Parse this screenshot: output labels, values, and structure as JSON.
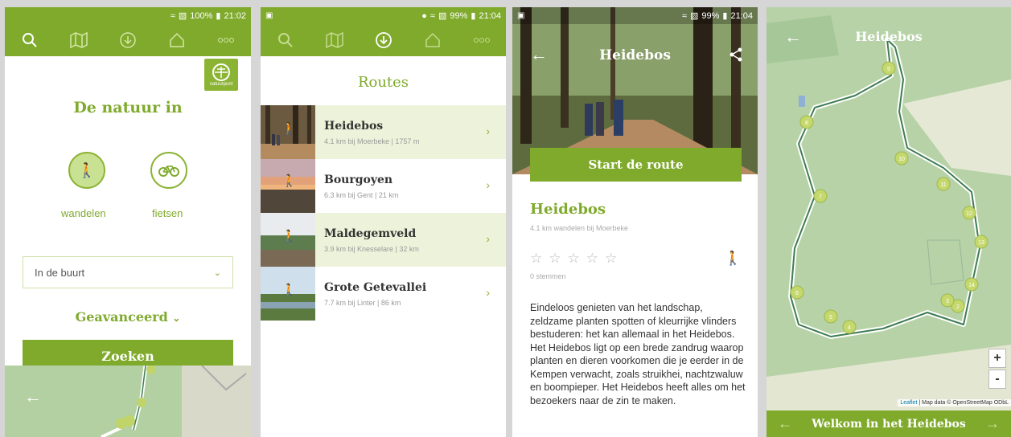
{
  "screen1": {
    "status": {
      "battery": "100%",
      "time": "21:02"
    },
    "logo_text": "natuurpunt",
    "title": "De natuur in",
    "modes": [
      {
        "label": "wandelen"
      },
      {
        "label": "fietsen"
      }
    ],
    "select_value": "In de buurt",
    "advanced_label": "Geavanceerd",
    "search_button": "Zoeken"
  },
  "screen2": {
    "status": {
      "battery": "99%",
      "time": "21:04"
    },
    "title": "Routes",
    "routes": [
      {
        "name": "Heidebos",
        "meta": "4.1 km bij Moerbeke | 1757 m"
      },
      {
        "name": "Bourgoyen",
        "meta": "6.3 km bij Gent | 21 km"
      },
      {
        "name": "Maldegemveld",
        "meta": "3.9 km bij Knesselare | 32 km"
      },
      {
        "name": "Grote Getevallei",
        "meta": "7.7 km bij Linter | 86 km"
      }
    ]
  },
  "screen3": {
    "status": {
      "battery": "99%",
      "time": "21:04"
    },
    "hero_title": "Heidebos",
    "start_button": "Start de route",
    "route_title": "Heidebos",
    "route_meta": "4.1 km wandelen bij Moerbeke",
    "votes": "0 stemmen",
    "description": "Eindeloos genieten van het landschap, zeldzame planten spotten of kleurrijke vlinders bestuderen: het kan allemaal in het Heidebos. Het Heidebos ligt op een brede zandrug waarop planten en dieren voorkomen die je eerder in de Kempen verwacht, zoals struikhei, nachtzwaluw en boompieper. Het Heidebos heeft alles om het bezoekers naar de zin te maken."
  },
  "screen4": {
    "title": "Heidebos",
    "zoom_in": "+",
    "zoom_out": "-",
    "attribution_link": "Leaflet",
    "attribution_text": " | Map data © OpenStreetMap ODbL",
    "bottom_label": "Welkom in het Heidebos",
    "markers": [
      "9",
      "8",
      "10",
      "7",
      "11",
      "12",
      "13",
      "14",
      "6",
      "5",
      "4",
      "2",
      "3"
    ]
  },
  "colors": {
    "brand_green": "#7faa2c",
    "light_green": "#edf3da"
  }
}
